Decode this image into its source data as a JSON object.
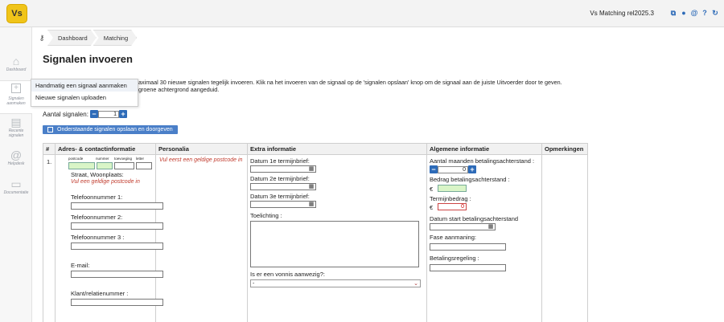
{
  "app": {
    "logo": "Vs",
    "version": "Vs Matching rel2025.3"
  },
  "top_icons": [
    "external-link-icon",
    "user-icon",
    "at-icon",
    "help-icon",
    "refresh-icon"
  ],
  "sidebar": [
    {
      "label": "Dashboard",
      "icon": "home-icon"
    },
    {
      "label": "Signalen aanmaken",
      "icon": "plus-square-icon"
    },
    {
      "label": "Recente signalen",
      "icon": "document-icon"
    },
    {
      "label": "Helpdesk",
      "icon": "at-icon"
    },
    {
      "label": "Documentatie",
      "icon": "book-icon"
    }
  ],
  "breadcrumb": [
    "Dashboard",
    "Matching"
  ],
  "page_title": "Signalen invoeren",
  "intro_line1": "aximaal 30 nieuwe signalen tegelijk invoeren. Klik na het invoeren van de signaal op de 'signalen opslaan' knop om de signaal aan de juiste Uitvoerder door te geven.",
  "intro_line2": "groene achtergrond aangeduid.",
  "popup": [
    "Handmatig een signaal aanmaken",
    "Nieuwe signalen uploaden"
  ],
  "aantal": {
    "label": "Aantal signalen:",
    "value": "1"
  },
  "save_button": "Onderstaande signalen opslaan en doorgeven",
  "table": {
    "headers": [
      "#",
      "Adres- & contactinformatie",
      "Personalia",
      "Extra informatie",
      "Algemene informatie",
      "Opmerkingen"
    ],
    "row_number": "1.",
    "address": {
      "sub_labels": [
        "postcode",
        "nummer",
        "toevoeging",
        "letter"
      ],
      "street_label": "Straat, Woonplaats:",
      "postcode_error": "Vul een geldige postcode in",
      "phone1": "Telefoonnummer 1:",
      "phone2": "Telefoonnummer 2:",
      "phone3": "Telefoonnummer 3 :",
      "email": "E-mail:",
      "client": "Klant/relatienummer :"
    },
    "personalia_error": "Vul eerst een geldige postcode in",
    "extra": {
      "datum1": "Datum 1e termijnbrief:",
      "datum2": "Datum 2e termijnbrief:",
      "datum3": "Datum 3e termijnbrief:",
      "toelichting": "Toelichting :",
      "vonnis": "Is er een vonnis aanwezig?:",
      "vonnis_value": "-"
    },
    "algemeen": {
      "maanden": "Aantal maanden betalingsachterstand :",
      "maanden_value": "0",
      "bedrag": "Bedrag betalingsachterstand :",
      "currency": "€",
      "termijn": "Termijnbedrag :",
      "termijn_value": "0",
      "datum_start": "Datum start betalingsachterstand",
      "fase": "Fase aanmaning:",
      "regeling": "Betalingsregeling :"
    }
  }
}
